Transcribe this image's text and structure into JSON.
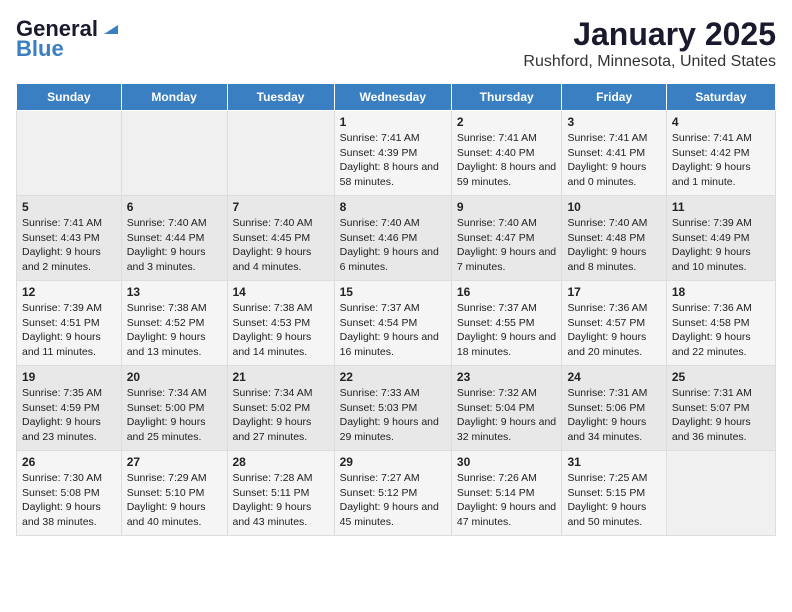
{
  "header": {
    "logo_line1": "General",
    "logo_line2": "Blue",
    "title": "January 2025",
    "subtitle": "Rushford, Minnesota, United States"
  },
  "days_of_week": [
    "Sunday",
    "Monday",
    "Tuesday",
    "Wednesday",
    "Thursday",
    "Friday",
    "Saturday"
  ],
  "weeks": [
    [
      {
        "day": "",
        "info": ""
      },
      {
        "day": "",
        "info": ""
      },
      {
        "day": "",
        "info": ""
      },
      {
        "day": "1",
        "info": "Sunrise: 7:41 AM\nSunset: 4:39 PM\nDaylight: 8 hours and 58 minutes."
      },
      {
        "day": "2",
        "info": "Sunrise: 7:41 AM\nSunset: 4:40 PM\nDaylight: 8 hours and 59 minutes."
      },
      {
        "day": "3",
        "info": "Sunrise: 7:41 AM\nSunset: 4:41 PM\nDaylight: 9 hours and 0 minutes."
      },
      {
        "day": "4",
        "info": "Sunrise: 7:41 AM\nSunset: 4:42 PM\nDaylight: 9 hours and 1 minute."
      }
    ],
    [
      {
        "day": "5",
        "info": "Sunrise: 7:41 AM\nSunset: 4:43 PM\nDaylight: 9 hours and 2 minutes."
      },
      {
        "day": "6",
        "info": "Sunrise: 7:40 AM\nSunset: 4:44 PM\nDaylight: 9 hours and 3 minutes."
      },
      {
        "day": "7",
        "info": "Sunrise: 7:40 AM\nSunset: 4:45 PM\nDaylight: 9 hours and 4 minutes."
      },
      {
        "day": "8",
        "info": "Sunrise: 7:40 AM\nSunset: 4:46 PM\nDaylight: 9 hours and 6 minutes."
      },
      {
        "day": "9",
        "info": "Sunrise: 7:40 AM\nSunset: 4:47 PM\nDaylight: 9 hours and 7 minutes."
      },
      {
        "day": "10",
        "info": "Sunrise: 7:40 AM\nSunset: 4:48 PM\nDaylight: 9 hours and 8 minutes."
      },
      {
        "day": "11",
        "info": "Sunrise: 7:39 AM\nSunset: 4:49 PM\nDaylight: 9 hours and 10 minutes."
      }
    ],
    [
      {
        "day": "12",
        "info": "Sunrise: 7:39 AM\nSunset: 4:51 PM\nDaylight: 9 hours and 11 minutes."
      },
      {
        "day": "13",
        "info": "Sunrise: 7:38 AM\nSunset: 4:52 PM\nDaylight: 9 hours and 13 minutes."
      },
      {
        "day": "14",
        "info": "Sunrise: 7:38 AM\nSunset: 4:53 PM\nDaylight: 9 hours and 14 minutes."
      },
      {
        "day": "15",
        "info": "Sunrise: 7:37 AM\nSunset: 4:54 PM\nDaylight: 9 hours and 16 minutes."
      },
      {
        "day": "16",
        "info": "Sunrise: 7:37 AM\nSunset: 4:55 PM\nDaylight: 9 hours and 18 minutes."
      },
      {
        "day": "17",
        "info": "Sunrise: 7:36 AM\nSunset: 4:57 PM\nDaylight: 9 hours and 20 minutes."
      },
      {
        "day": "18",
        "info": "Sunrise: 7:36 AM\nSunset: 4:58 PM\nDaylight: 9 hours and 22 minutes."
      }
    ],
    [
      {
        "day": "19",
        "info": "Sunrise: 7:35 AM\nSunset: 4:59 PM\nDaylight: 9 hours and 23 minutes."
      },
      {
        "day": "20",
        "info": "Sunrise: 7:34 AM\nSunset: 5:00 PM\nDaylight: 9 hours and 25 minutes."
      },
      {
        "day": "21",
        "info": "Sunrise: 7:34 AM\nSunset: 5:02 PM\nDaylight: 9 hours and 27 minutes."
      },
      {
        "day": "22",
        "info": "Sunrise: 7:33 AM\nSunset: 5:03 PM\nDaylight: 9 hours and 29 minutes."
      },
      {
        "day": "23",
        "info": "Sunrise: 7:32 AM\nSunset: 5:04 PM\nDaylight: 9 hours and 32 minutes."
      },
      {
        "day": "24",
        "info": "Sunrise: 7:31 AM\nSunset: 5:06 PM\nDaylight: 9 hours and 34 minutes."
      },
      {
        "day": "25",
        "info": "Sunrise: 7:31 AM\nSunset: 5:07 PM\nDaylight: 9 hours and 36 minutes."
      }
    ],
    [
      {
        "day": "26",
        "info": "Sunrise: 7:30 AM\nSunset: 5:08 PM\nDaylight: 9 hours and 38 minutes."
      },
      {
        "day": "27",
        "info": "Sunrise: 7:29 AM\nSunset: 5:10 PM\nDaylight: 9 hours and 40 minutes."
      },
      {
        "day": "28",
        "info": "Sunrise: 7:28 AM\nSunset: 5:11 PM\nDaylight: 9 hours and 43 minutes."
      },
      {
        "day": "29",
        "info": "Sunrise: 7:27 AM\nSunset: 5:12 PM\nDaylight: 9 hours and 45 minutes."
      },
      {
        "day": "30",
        "info": "Sunrise: 7:26 AM\nSunset: 5:14 PM\nDaylight: 9 hours and 47 minutes."
      },
      {
        "day": "31",
        "info": "Sunrise: 7:25 AM\nSunset: 5:15 PM\nDaylight: 9 hours and 50 minutes."
      },
      {
        "day": "",
        "info": ""
      }
    ]
  ]
}
